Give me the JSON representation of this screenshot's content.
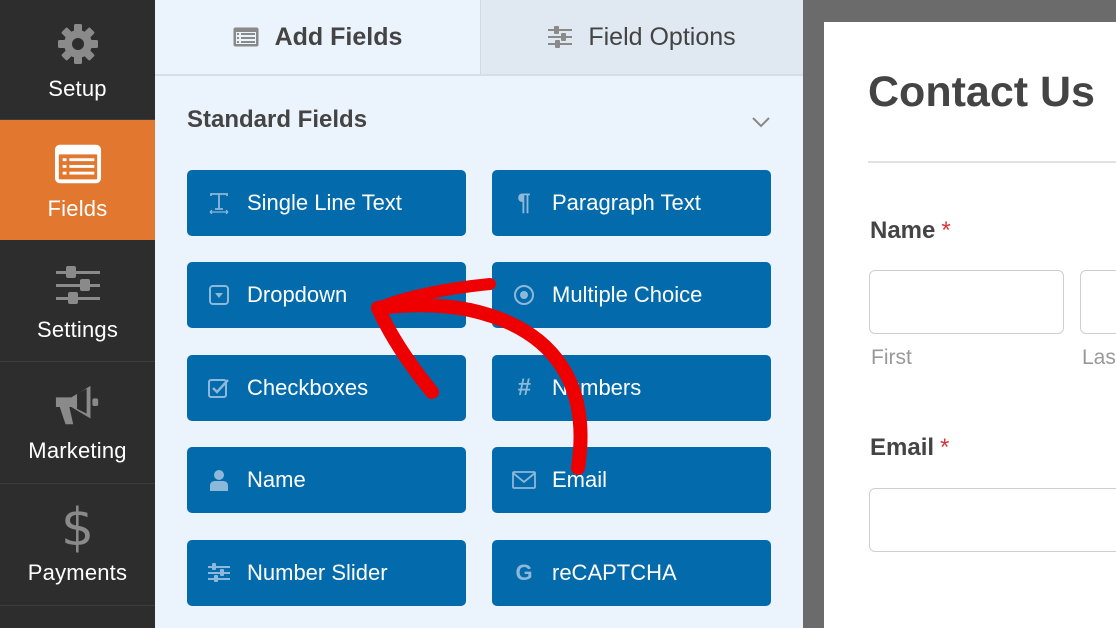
{
  "sidebar": {
    "items": [
      {
        "label": "Setup",
        "icon": "gear-icon",
        "active": false
      },
      {
        "label": "Fields",
        "icon": "fields-list-icon",
        "active": true
      },
      {
        "label": "Settings",
        "icon": "sliders-icon",
        "active": false
      },
      {
        "label": "Marketing",
        "icon": "megaphone-icon",
        "active": false
      },
      {
        "label": "Payments",
        "icon": "dollar-icon",
        "active": false
      }
    ]
  },
  "panel": {
    "tabs": [
      {
        "label": "Add Fields",
        "icon": "list-icon",
        "active": true
      },
      {
        "label": "Field Options",
        "icon": "sliders-icon",
        "active": false
      }
    ],
    "section": {
      "title": "Standard Fields",
      "toggle_icon": "chevron-down-icon"
    },
    "fields": [
      {
        "label": "Single Line Text",
        "icon": "text-cursor-icon"
      },
      {
        "label": "Paragraph Text",
        "icon": "pilcrow-icon"
      },
      {
        "label": "Dropdown",
        "icon": "dropdown-icon"
      },
      {
        "label": "Multiple Choice",
        "icon": "radio-icon"
      },
      {
        "label": "Checkboxes",
        "icon": "checkbox-icon"
      },
      {
        "label": "Numbers",
        "icon": "hash-icon"
      },
      {
        "label": "Name",
        "icon": "user-icon"
      },
      {
        "label": "Email",
        "icon": "envelope-icon"
      },
      {
        "label": "Number Slider",
        "icon": "sliders-icon"
      },
      {
        "label": "reCAPTCHA",
        "icon": "google-icon"
      }
    ]
  },
  "preview": {
    "form_title": "Contact Us",
    "fields": [
      {
        "label": "Name",
        "required": "*",
        "sublabels": [
          "First",
          "Last"
        ]
      },
      {
        "label": "Email",
        "required": "*"
      }
    ]
  },
  "annotation": {
    "type": "red curved arrow",
    "from": "Email",
    "to": "Dropdown",
    "color": "#ee0000"
  },
  "colors": {
    "sidebar_bg": "#2d2d2d",
    "sidebar_active": "#e27730",
    "panel_bg": "#ebf3fc",
    "field_button": "#036aab",
    "preview_frame": "#6b6b6b",
    "required": "#d63638"
  }
}
